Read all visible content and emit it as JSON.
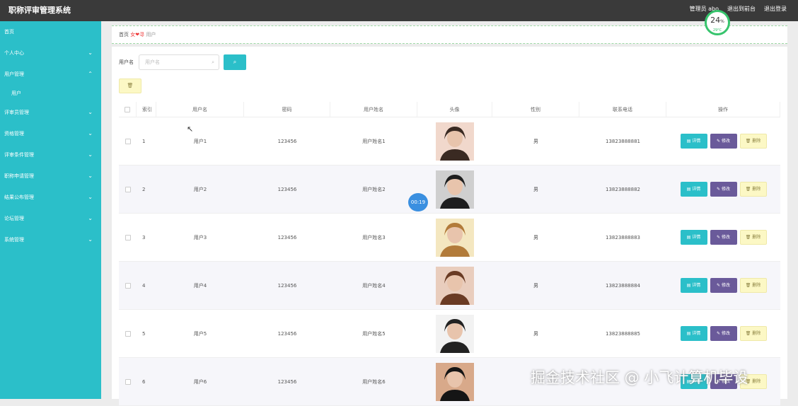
{
  "app": {
    "title": "职称评审管理系统",
    "admin_label": "管理员 abo",
    "back_label": "退出到前台",
    "logout_label": "退出登录"
  },
  "sidebar": {
    "items": [
      {
        "label": "首页",
        "has_arrow": false
      },
      {
        "label": "个人中心",
        "has_arrow": true
      },
      {
        "label": "用户管理",
        "has_arrow": true,
        "expanded": true
      },
      {
        "label": "用户",
        "sub": true
      },
      {
        "label": "评审员管理",
        "has_arrow": true
      },
      {
        "label": "资格管理",
        "has_arrow": true
      },
      {
        "label": "评审条件管理",
        "has_arrow": true
      },
      {
        "label": "职称申请管理",
        "has_arrow": true
      },
      {
        "label": "结果公布管理",
        "has_arrow": true
      },
      {
        "label": "论坛管理",
        "has_arrow": true
      },
      {
        "label": "系统管理",
        "has_arrow": true
      }
    ]
  },
  "breadcrumb": {
    "home": "首页",
    "heart": "女❤寻",
    "current": "用户"
  },
  "gauge": {
    "percent": "24",
    "unit": "%",
    "temp": "29°C"
  },
  "search": {
    "label": "用户名",
    "placeholder": "用户名"
  },
  "table": {
    "headers": [
      "索引",
      "用户名",
      "密码",
      "用户姓名",
      "头像",
      "性别",
      "联系电话",
      "操作"
    ],
    "rows": [
      {
        "idx": "1",
        "user": "用户1",
        "pwd": "123456",
        "name": "用户姓名1",
        "sex": "男",
        "tel": "13823888881"
      },
      {
        "idx": "2",
        "user": "用户2",
        "pwd": "123456",
        "name": "用户姓名2",
        "sex": "男",
        "tel": "13823888882"
      },
      {
        "idx": "3",
        "user": "用户3",
        "pwd": "123456",
        "name": "用户姓名3",
        "sex": "男",
        "tel": "13823888883"
      },
      {
        "idx": "4",
        "user": "用户4",
        "pwd": "123456",
        "name": "用户姓名4",
        "sex": "男",
        "tel": "13823888884"
      },
      {
        "idx": "5",
        "user": "用户5",
        "pwd": "123456",
        "name": "用户姓名5",
        "sex": "男",
        "tel": "13823888885"
      },
      {
        "idx": "6",
        "user": "用户6",
        "pwd": "123456",
        "name": "用户姓名6",
        "sex": "",
        "tel": ""
      }
    ],
    "actions": {
      "detail": "详情",
      "edit": "修改",
      "remove": "删除"
    }
  },
  "timer": "00:19",
  "watermark": "掘金技术社区 @ 小飞计算机毕设",
  "colors": {
    "accent": "#2bbfc9",
    "topbar": "#3a3a3a",
    "edit": "#6a5a9a",
    "remove": "#fcf8c5"
  }
}
